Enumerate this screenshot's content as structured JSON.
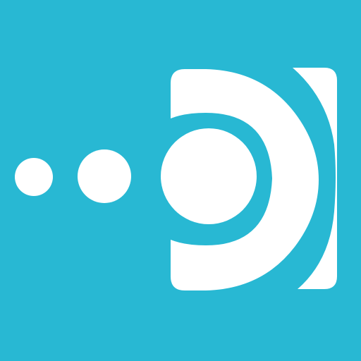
{
  "icon": {
    "name": "app-logo-icon",
    "background_color": "#28b8d3",
    "foreground_color": "#ffffff"
  }
}
